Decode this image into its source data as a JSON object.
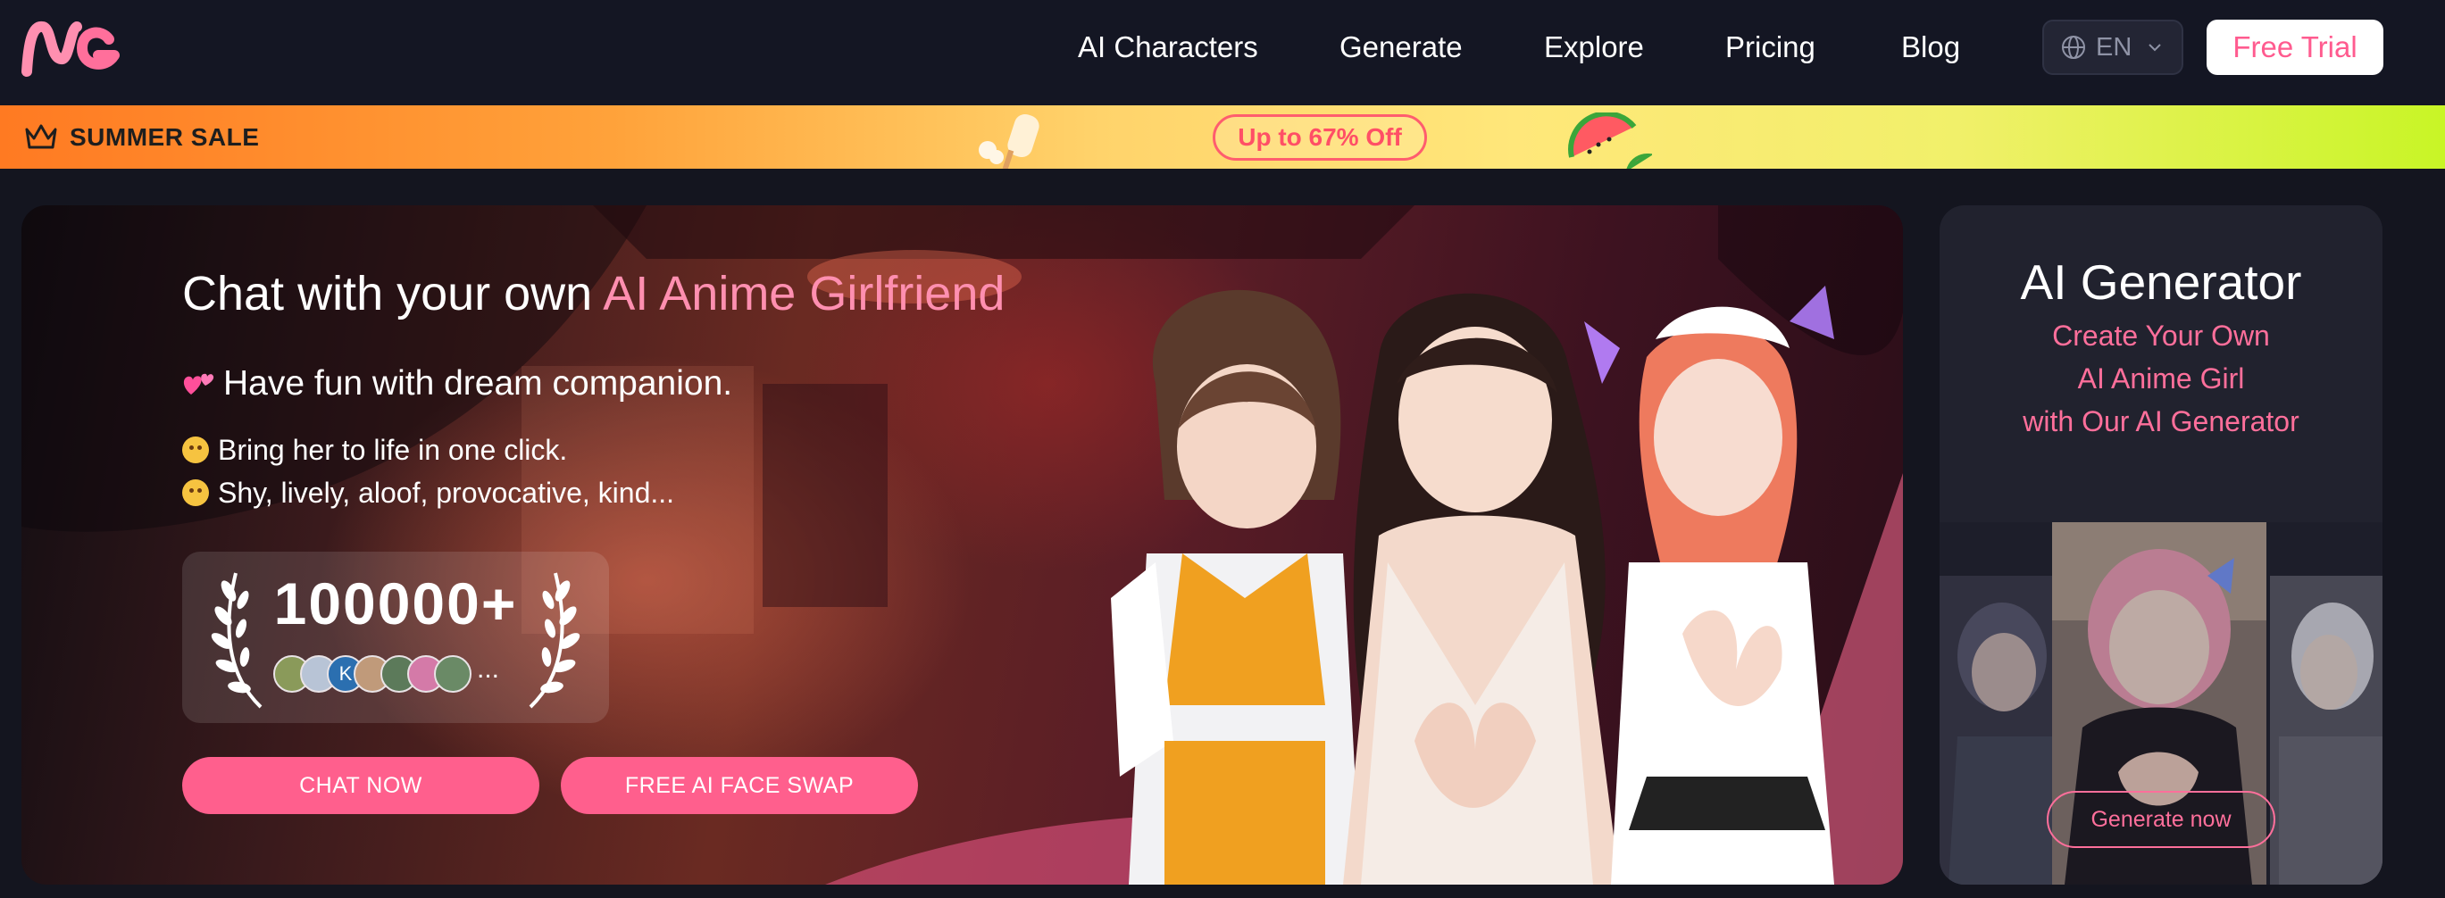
{
  "header": {
    "logo_alt": "NG",
    "nav": [
      "AI Characters",
      "Generate",
      "Explore",
      "Pricing",
      "Blog"
    ],
    "language": "EN",
    "free_trial_label": "Free Trial"
  },
  "sale_banner": {
    "label": "SUMMER SALE",
    "badge": "Up to 67% Off"
  },
  "hero": {
    "title_prefix": "Chat with your own ",
    "title_accent": "AI Anime Girlfriend",
    "subtitle": "Have fun with dream companion.",
    "bullets": [
      "Bring her to life in one click.",
      "Shy, lively, aloof, provocative, kind..."
    ],
    "user_count": "100000+",
    "avatar_letter": "K",
    "more": "...",
    "chat_button": "CHAT NOW",
    "face_swap_button": "FREE AI FACE SWAP"
  },
  "side_card": {
    "title": "AI Generator",
    "lines": [
      "Create Your Own",
      "AI Anime Girl",
      "with Our AI Generator"
    ],
    "generate_button": "Generate now"
  },
  "colors": {
    "accent_pink": "#ff5f8d",
    "header_bg": "#141623",
    "card_bg": "#21222e"
  }
}
